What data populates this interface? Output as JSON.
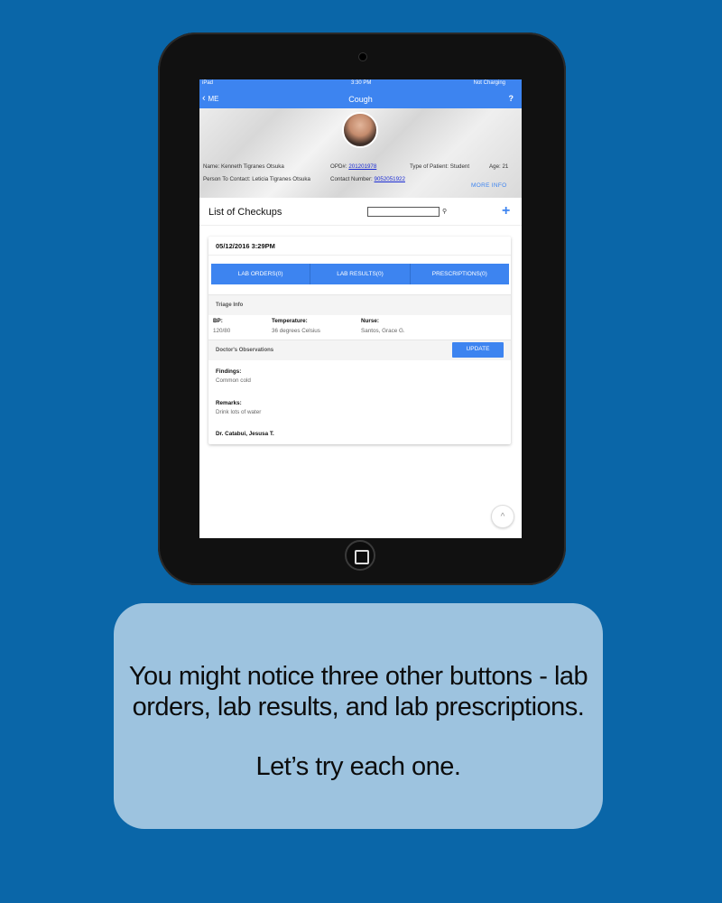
{
  "status_bar": {
    "device": "iPad",
    "time": "3:30 PM",
    "battery": "Not Charging"
  },
  "nav": {
    "back_label": "ME",
    "title": "Cough",
    "help": "?",
    "back_icon": "chevron-left-icon"
  },
  "patient": {
    "name_label": "Name:",
    "name": "Kenneth Tigranes Otsuka",
    "opd_label": "OPD#:",
    "opd": "201201978",
    "type_label": "Type of Patient:",
    "type": "Student",
    "age_label": "Age:",
    "age": "21",
    "contact_person_label": "Person To Contact:",
    "contact_person": "Leticia Tigranes Otsuka",
    "contact_number_label": "Contact Number:",
    "contact_number": "9052051922",
    "more_info": "MORE INFO"
  },
  "checkups": {
    "title": "List of Checkups",
    "search_value": "",
    "add": "+",
    "entry": {
      "date": "05/12/2016 3:29PM",
      "tabs": [
        "LAB ORDERS(0)",
        "LAB RESULTS(0)",
        "PRESCRIPTIONS(0)"
      ],
      "triage_title": "Triage Info",
      "bp_label": "BP:",
      "bp": "120/80",
      "temp_label": "Temperature:",
      "temp": "36 degrees Celsius",
      "nurse_label": "Nurse:",
      "nurse": "Santos, Grace G.",
      "obs_title": "Doctor's Observations",
      "update": "UPDATE",
      "findings_label": "Findings:",
      "findings": "Common cold",
      "remarks_label": "Remarks:",
      "remarks": "Drink lots of water",
      "doctor": "Dr. Catabui, Jesusa T."
    }
  },
  "scroll_top": "^",
  "caption": {
    "line1": "You might notice three other buttons - lab",
    "line2": "orders, lab results, and lab prescriptions.",
    "line3": "Let’s try each one."
  },
  "colors": {
    "background": "#0a66a8",
    "accent": "#3d84f0",
    "caption_bg": "#9dc3df",
    "link": "#1a2bd3"
  }
}
